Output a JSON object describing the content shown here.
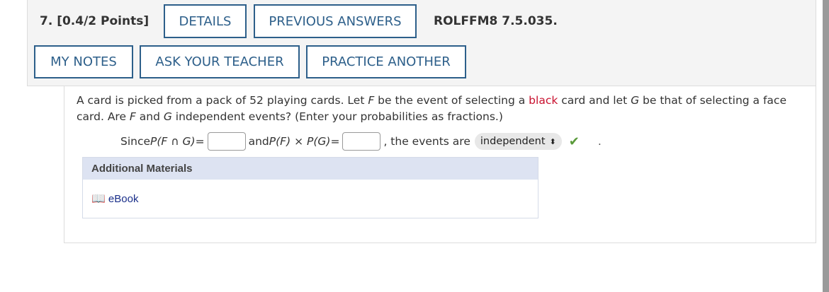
{
  "question": {
    "number_points": "7.  [0.4/2 Points]",
    "code": "ROLFFM8 7.5.035.",
    "buttons": {
      "details": "DETAILS",
      "previous_answers": "PREVIOUS ANSWERS",
      "my_notes": "MY NOTES",
      "ask_teacher": "ASK YOUR TEACHER",
      "practice_another": "PRACTICE ANOTHER"
    },
    "text": {
      "p1": "A card is picked from a pack of 52 playing cards. Let ",
      "F": "F",
      "p2": " be the event of selecting a ",
      "black": "black",
      "p3": " card and let ",
      "G": "G",
      "p4": " be that of selecting a face card. Are ",
      "F2": "F",
      "p5": " and ",
      "G2": "G",
      "p6": " independent events? (Enter your probabilities as fractions.)"
    },
    "answer": {
      "since": "Since ",
      "expr1": "P(F ∩ G)",
      "eq1": " = ",
      "and": "and ",
      "expr2": "P(F) × P(G)",
      "eq2": " = ",
      "events_are": ", the events are ",
      "selected": "independent",
      "dot": "."
    },
    "materials": {
      "title": "Additional Materials",
      "ebook": "eBook"
    }
  },
  "icons": {
    "select_arrows": "up-down-arrows",
    "check": "check-icon",
    "book": "book-icon"
  },
  "colors": {
    "button_border": "#2d5f8a",
    "highlight_red": "#c8102e",
    "check_green": "#5a9a3a",
    "materials_header": "#dde3f2",
    "link_blue": "#1a2f8a"
  }
}
